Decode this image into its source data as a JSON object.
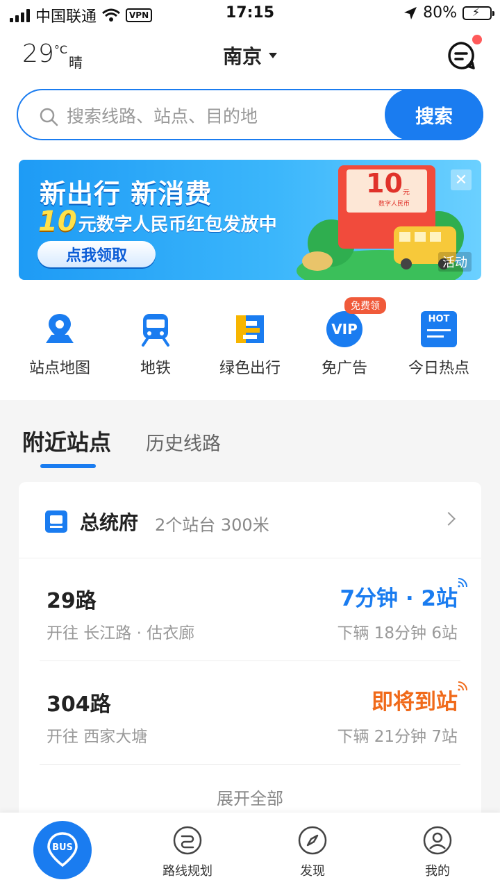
{
  "status_bar": {
    "carrier": "中国联通",
    "vpn": "VPN",
    "time": "17:15",
    "battery": "80%",
    "battery_level": 0.8
  },
  "header": {
    "temperature": "29",
    "temp_unit": "°C",
    "weather": "晴",
    "city": "南京"
  },
  "search": {
    "placeholder": "搜索线路、站点、目的地",
    "button_label": "搜索"
  },
  "banner": {
    "title": "新出行 新消费",
    "amount": "10",
    "subtitle": "元数字人民币红包发放中",
    "cta": "点我领取",
    "tag": "活动",
    "card_amount": "10",
    "card_unit": "元",
    "card_text": "数字人民币"
  },
  "quick_menu": {
    "items": [
      {
        "label": "站点地图"
      },
      {
        "label": "地铁"
      },
      {
        "label": "绿色出行"
      },
      {
        "label": "免广告",
        "badge": "免费领",
        "icon_text": "VIP"
      },
      {
        "label": "今日热点",
        "icon_text": "HOT"
      }
    ]
  },
  "nearby": {
    "tabs": [
      "附近站点",
      "历史线路"
    ],
    "stop": {
      "name": "总统府",
      "meta": "2个站台 300米"
    },
    "routes": [
      {
        "name": "29路",
        "direction": "开往 长江路 · 估衣廊",
        "eta": "7分钟 · 2站",
        "eta_color": "#1a7cf0",
        "next": "下辆 18分钟 6站"
      },
      {
        "name": "304路",
        "direction": "开往 西家大塘",
        "eta": "即将到站",
        "eta_color": "#f06a1a",
        "next": "下辆 21分钟 7站"
      }
    ],
    "expand_label": "展开全部"
  },
  "tabbar": {
    "home_icon_text": "BUS",
    "items": [
      {
        "label": "路线规划"
      },
      {
        "label": "发现"
      },
      {
        "label": "我的"
      }
    ]
  },
  "colors": {
    "accent": "#1a7cf0",
    "warning": "#f06a1a",
    "badge": "#f05a3a"
  }
}
